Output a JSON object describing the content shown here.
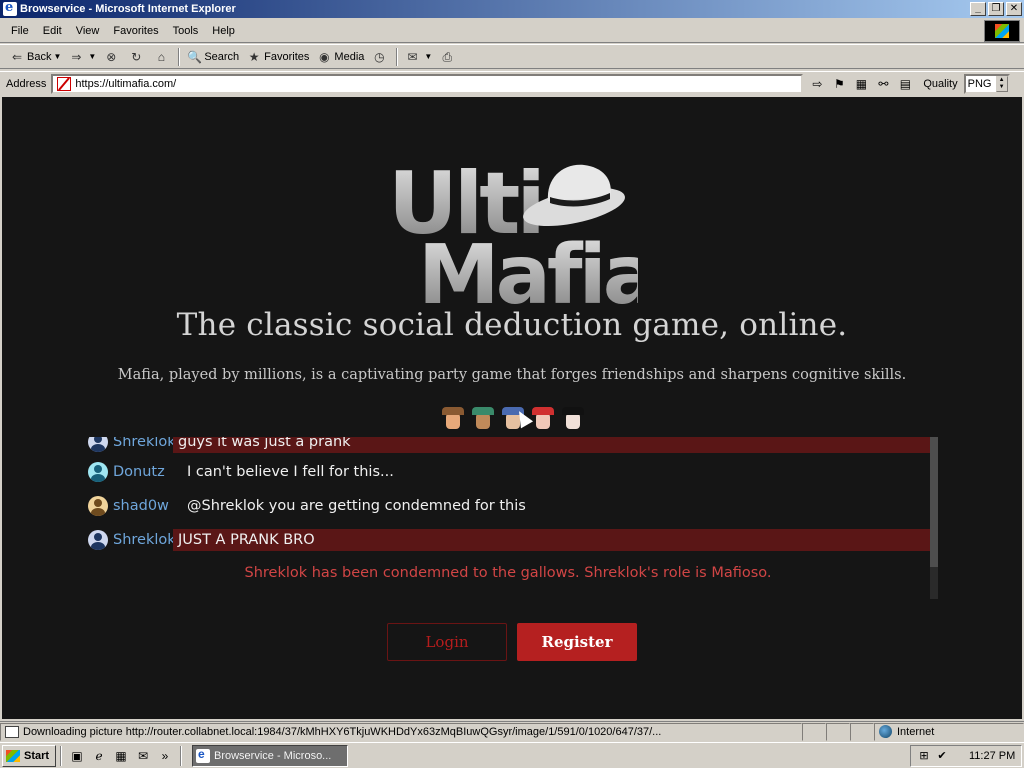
{
  "window": {
    "title": "Browservice - Microsoft Internet Explorer"
  },
  "menu": {
    "items": [
      "File",
      "Edit",
      "View",
      "Favorites",
      "Tools",
      "Help"
    ]
  },
  "toolbar": {
    "back_label": "Back",
    "search_label": "Search",
    "favorites_label": "Favorites",
    "media_label": "Media"
  },
  "address": {
    "label": "Address",
    "url": "https://ultimafia.com/",
    "quality_label": "Quality",
    "quality_value": "PNG"
  },
  "page": {
    "logo_line1": "Ulti",
    "logo_line2": "Mafia",
    "tagline": "The classic social deduction game, online.",
    "subline": "Mafia, played by millions, is a captivating party game that forges friendships and sharpens cognitive skills.",
    "chat": [
      {
        "name": "Shreklok",
        "text": "guys it was just a prank",
        "highlight": true
      },
      {
        "name": "Donutz",
        "text": "I can't believe I fell for this...",
        "highlight": false
      },
      {
        "name": "shad0w",
        "text": "@Shreklok you are getting condemned for this",
        "highlight": false
      },
      {
        "name": "Shreklok",
        "text": "JUST A PRANK BRO",
        "highlight": true
      }
    ],
    "system_message": "Shreklok has been condemned to the gallows. Shreklok's role is Mafioso.",
    "login_label": "Login",
    "register_label": "Register"
  },
  "status": {
    "text": "Downloading picture http://router.collabnet.local:1984/37/kMhHXY6TkjuWKHDdYx63zMqBIuwQGsyr/image/1/591/0/1020/647/37/...",
    "zone": "Internet"
  },
  "taskbar": {
    "start_label": "Start",
    "task_label": "Browservice - Microso...",
    "clock": "11:27 PM"
  },
  "colors": {
    "page_bg": "#151515",
    "accent_red": "#b52020",
    "name_blue": "#6fa6db",
    "system_red": "#d14545"
  }
}
